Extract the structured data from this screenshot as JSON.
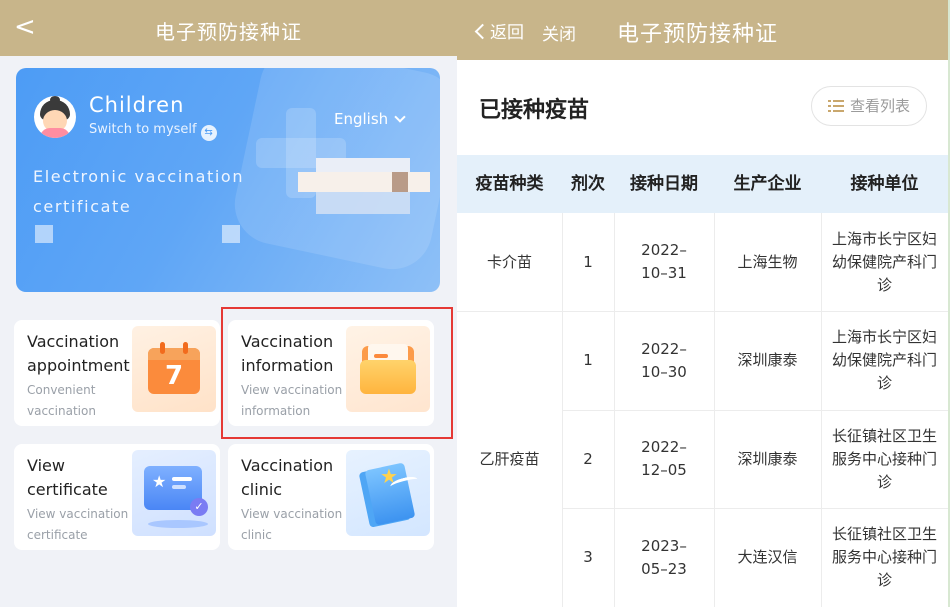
{
  "left": {
    "header": {
      "back": "<",
      "title": "电子预防接种证"
    },
    "card": {
      "name": "Children",
      "switch_label": "Switch to myself",
      "switch_icon": "⇆",
      "language": "English",
      "cert_text": "Electronic vaccination certificate"
    },
    "tiles": {
      "appointment": {
        "title": "Vaccination appointment",
        "subtitle": "Convenient vaccination",
        "icon_number": "7"
      },
      "information": {
        "title": "Vaccination information",
        "subtitle": "View vaccination information"
      },
      "certificate": {
        "title": "View certificate",
        "subtitle": "View vaccination certificate",
        "star": "★",
        "badge": "✓"
      },
      "clinic": {
        "title": "Vaccination clinic",
        "subtitle": "View vaccination clinic",
        "star": "★"
      }
    }
  },
  "right": {
    "header": {
      "back": "返回",
      "close": "关闭",
      "title": "电子预防接种证"
    },
    "section_title": "已接种疫苗",
    "view_list": "查看列表",
    "table": {
      "headers": [
        "疫苗种类",
        "剂次",
        "接种日期",
        "生产企业",
        "接种单位"
      ],
      "groups": [
        {
          "vaccine": "卡介苗"
        },
        {
          "vaccine": "乙肝疫苗"
        }
      ],
      "rows": [
        {
          "dose": "1",
          "date": "2022–10–31",
          "maker": "上海生物",
          "unit": "上海市长宁区妇幼保健院产科门诊"
        },
        {
          "dose": "1",
          "date": "2022–10–30",
          "maker": "深圳康泰",
          "unit": "上海市长宁区妇幼保健院产科门诊"
        },
        {
          "dose": "2",
          "date": "2022–12–05",
          "maker": "深圳康泰",
          "unit": "长征镇社区卫生服务中心接种门诊"
        },
        {
          "dose": "3",
          "date": "2023–05–23",
          "maker": "大连汉信",
          "unit": "长征镇社区卫生服务中心接种门诊"
        }
      ]
    },
    "colors": {
      "header_bg": "#c8b58a",
      "table_head_bg": "#e4f0fa",
      "highlight": "#e53935"
    }
  }
}
